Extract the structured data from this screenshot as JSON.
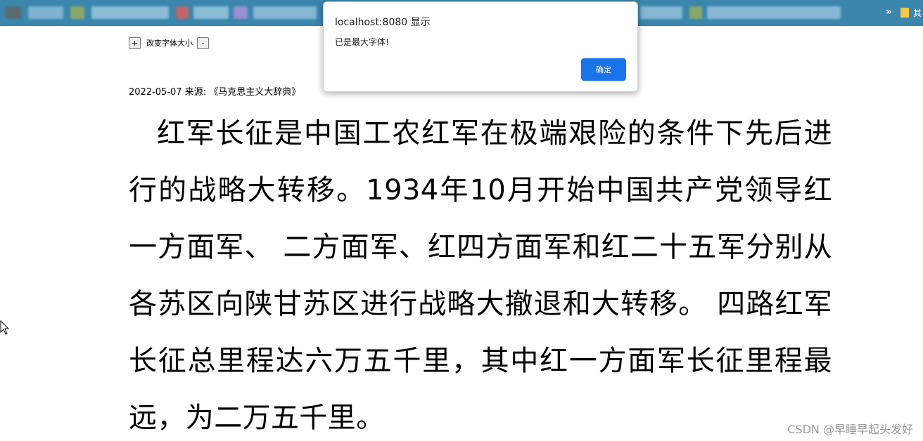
{
  "browser": {
    "bookmarks_more": "»",
    "bookmark_folder_label": "其"
  },
  "font_controls": {
    "increase_label": "+",
    "label": "改变字体大小",
    "decrease_label": "-"
  },
  "article": {
    "meta": "2022-05-07 来源: 《马克思主义大辞典》",
    "body": "红军长征是中国工农红军在极端艰险的条件下先后进行的战略大转移。1934年10月开始中国共产党领导红一方面军、 二方面军、红四方面军和红二十五军分别从各苏区向陕甘苏区进行战略大撤退和大转移。 四路红军长征总里程达六万五千里，其中红一方面军长征里程最远，为二万五千里。"
  },
  "alert": {
    "title": "localhost:8080 显示",
    "message": "已是最大字体!",
    "ok_label": "确定"
  },
  "watermark": "CSDN @早睡早起头发好",
  "colors": {
    "bookmarks_bar": "#3a86ad",
    "alert_button": "#1a73e8"
  }
}
